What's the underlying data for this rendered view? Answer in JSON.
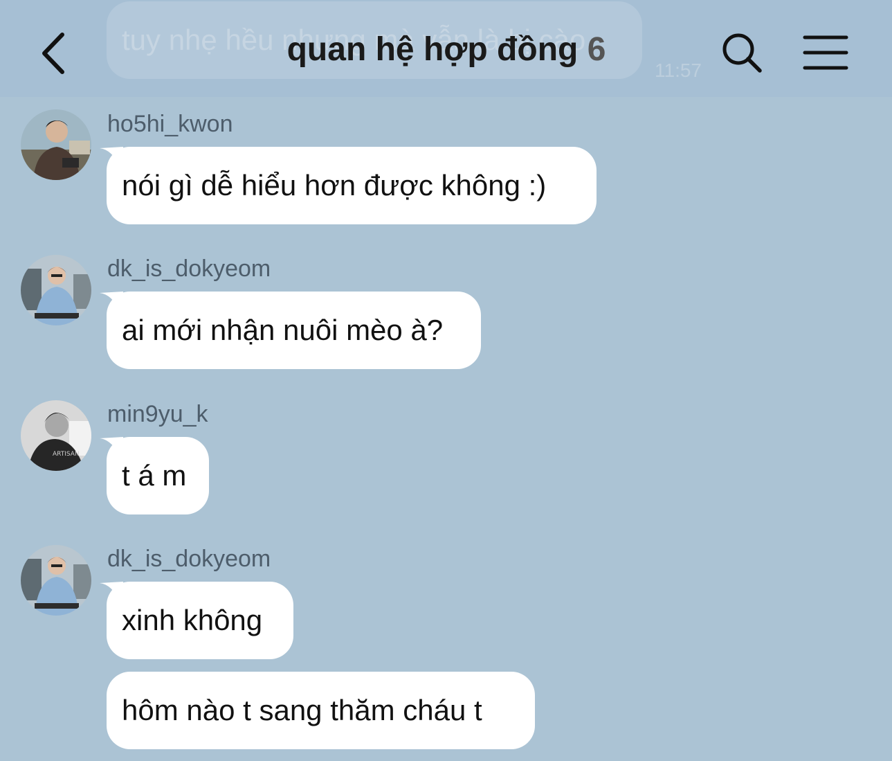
{
  "header": {
    "title": "quan hệ hợp đồng",
    "member_count": "6",
    "ghost_message": "tuy nhẹ hều nhưng mà vẫn là bị cào",
    "ghost_time": "11:57",
    "back_icon": "chevron-left-icon",
    "search_icon": "search-icon",
    "menu_icon": "hamburger-menu-icon"
  },
  "messages": [
    {
      "user": "ho5hi_kwon",
      "text": "nói gì dễ hiểu hơn được không :)"
    },
    {
      "user": "dk_is_dokyeom",
      "text": "ai mới nhận nuôi mèo à?"
    },
    {
      "user": "min9yu_k",
      "text": "t á m"
    },
    {
      "user": "dk_is_dokyeom",
      "texts": [
        "xinh không",
        "hôm nào t sang thăm cháu t"
      ]
    }
  ],
  "colors": {
    "background": "#abc3d4",
    "header": "#a6bfd4",
    "bubble": "#ffffff",
    "text": "#111111"
  }
}
